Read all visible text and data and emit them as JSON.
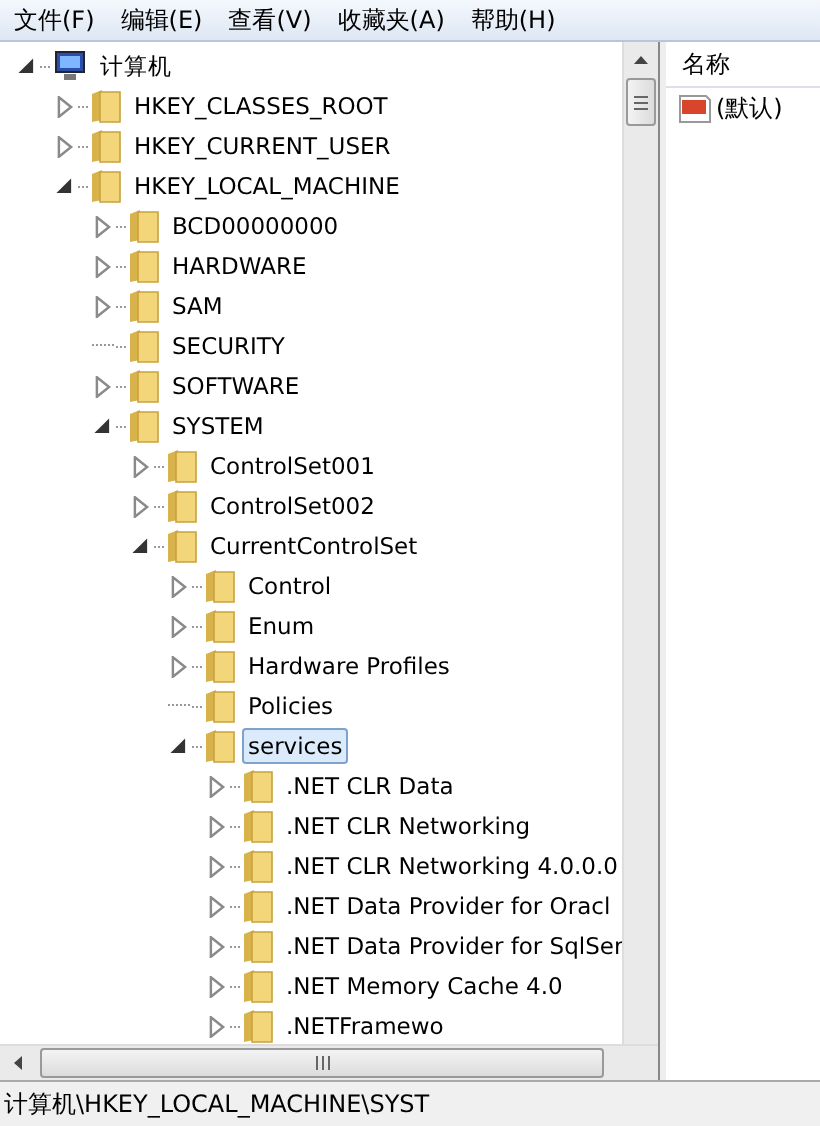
{
  "menu": [
    "文件(F)",
    "编辑(E)",
    "查看(V)",
    "收藏夹(A)",
    "帮助(H)"
  ],
  "tree": [
    {
      "label": "计算机",
      "kind": "computer",
      "expandable": true,
      "expanded": true,
      "selected": false,
      "children": [
        {
          "label": "HKEY_CLASSES_ROOT",
          "kind": "folder",
          "expandable": true,
          "expanded": false,
          "selected": false
        },
        {
          "label": "HKEY_CURRENT_USER",
          "kind": "folder",
          "expandable": true,
          "expanded": false,
          "selected": false
        },
        {
          "label": "HKEY_LOCAL_MACHINE",
          "kind": "folder",
          "expandable": true,
          "expanded": true,
          "selected": false,
          "children": [
            {
              "label": "BCD00000000",
              "kind": "folder",
              "expandable": true,
              "expanded": false,
              "selected": false
            },
            {
              "label": "HARDWARE",
              "kind": "folder",
              "expandable": true,
              "expanded": false,
              "selected": false
            },
            {
              "label": "SAM",
              "kind": "folder",
              "expandable": true,
              "expanded": false,
              "selected": false
            },
            {
              "label": "SECURITY",
              "kind": "folder",
              "expandable": false,
              "selected": false
            },
            {
              "label": "SOFTWARE",
              "kind": "folder",
              "expandable": true,
              "expanded": false,
              "selected": false
            },
            {
              "label": "SYSTEM",
              "kind": "folder",
              "expandable": true,
              "expanded": true,
              "selected": false,
              "children": [
                {
                  "label": "ControlSet001",
                  "kind": "folder",
                  "expandable": true,
                  "expanded": false,
                  "selected": false
                },
                {
                  "label": "ControlSet002",
                  "kind": "folder",
                  "expandable": true,
                  "expanded": false,
                  "selected": false
                },
                {
                  "label": "CurrentControlSet",
                  "kind": "folder",
                  "expandable": true,
                  "expanded": true,
                  "selected": false,
                  "children": [
                    {
                      "label": "Control",
                      "kind": "folder",
                      "expandable": true,
                      "expanded": false,
                      "selected": false
                    },
                    {
                      "label": "Enum",
                      "kind": "folder",
                      "expandable": true,
                      "expanded": false,
                      "selected": false
                    },
                    {
                      "label": "Hardware Profiles",
                      "kind": "folder",
                      "expandable": true,
                      "expanded": false,
                      "selected": false
                    },
                    {
                      "label": "Policies",
                      "kind": "folder",
                      "expandable": false,
                      "selected": false
                    },
                    {
                      "label": "services",
                      "kind": "folder",
                      "expandable": true,
                      "expanded": true,
                      "selected": true,
                      "children": [
                        {
                          "label": ".NET CLR Data",
                          "kind": "folder",
                          "expandable": true,
                          "expanded": false,
                          "selected": false
                        },
                        {
                          "label": ".NET CLR Networking",
                          "kind": "folder",
                          "expandable": true,
                          "expanded": false,
                          "selected": false
                        },
                        {
                          "label": ".NET CLR Networking 4.0.0.0",
                          "kind": "folder",
                          "expandable": true,
                          "expanded": false,
                          "selected": false
                        },
                        {
                          "label": ".NET Data Provider for Oracl",
                          "kind": "folder",
                          "expandable": true,
                          "expanded": false,
                          "selected": false
                        },
                        {
                          "label": ".NET Data Provider for SqlSer",
                          "kind": "folder",
                          "expandable": true,
                          "expanded": false,
                          "selected": false
                        },
                        {
                          "label": ".NET Memory Cache 4.0",
                          "kind": "folder",
                          "expandable": true,
                          "expanded": false,
                          "selected": false
                        },
                        {
                          "label": ".NETFramewo",
                          "kind": "folder",
                          "expandable": true,
                          "expanded": false,
                          "selected": false
                        }
                      ]
                    }
                  ]
                }
              ]
            }
          ]
        }
      ]
    }
  ],
  "values": {
    "columns": [
      "名称"
    ],
    "rows": [
      {
        "name": "(默认)"
      }
    ]
  },
  "status_bar": "计算机\\HKEY_LOCAL_MACHINE\\SYST"
}
